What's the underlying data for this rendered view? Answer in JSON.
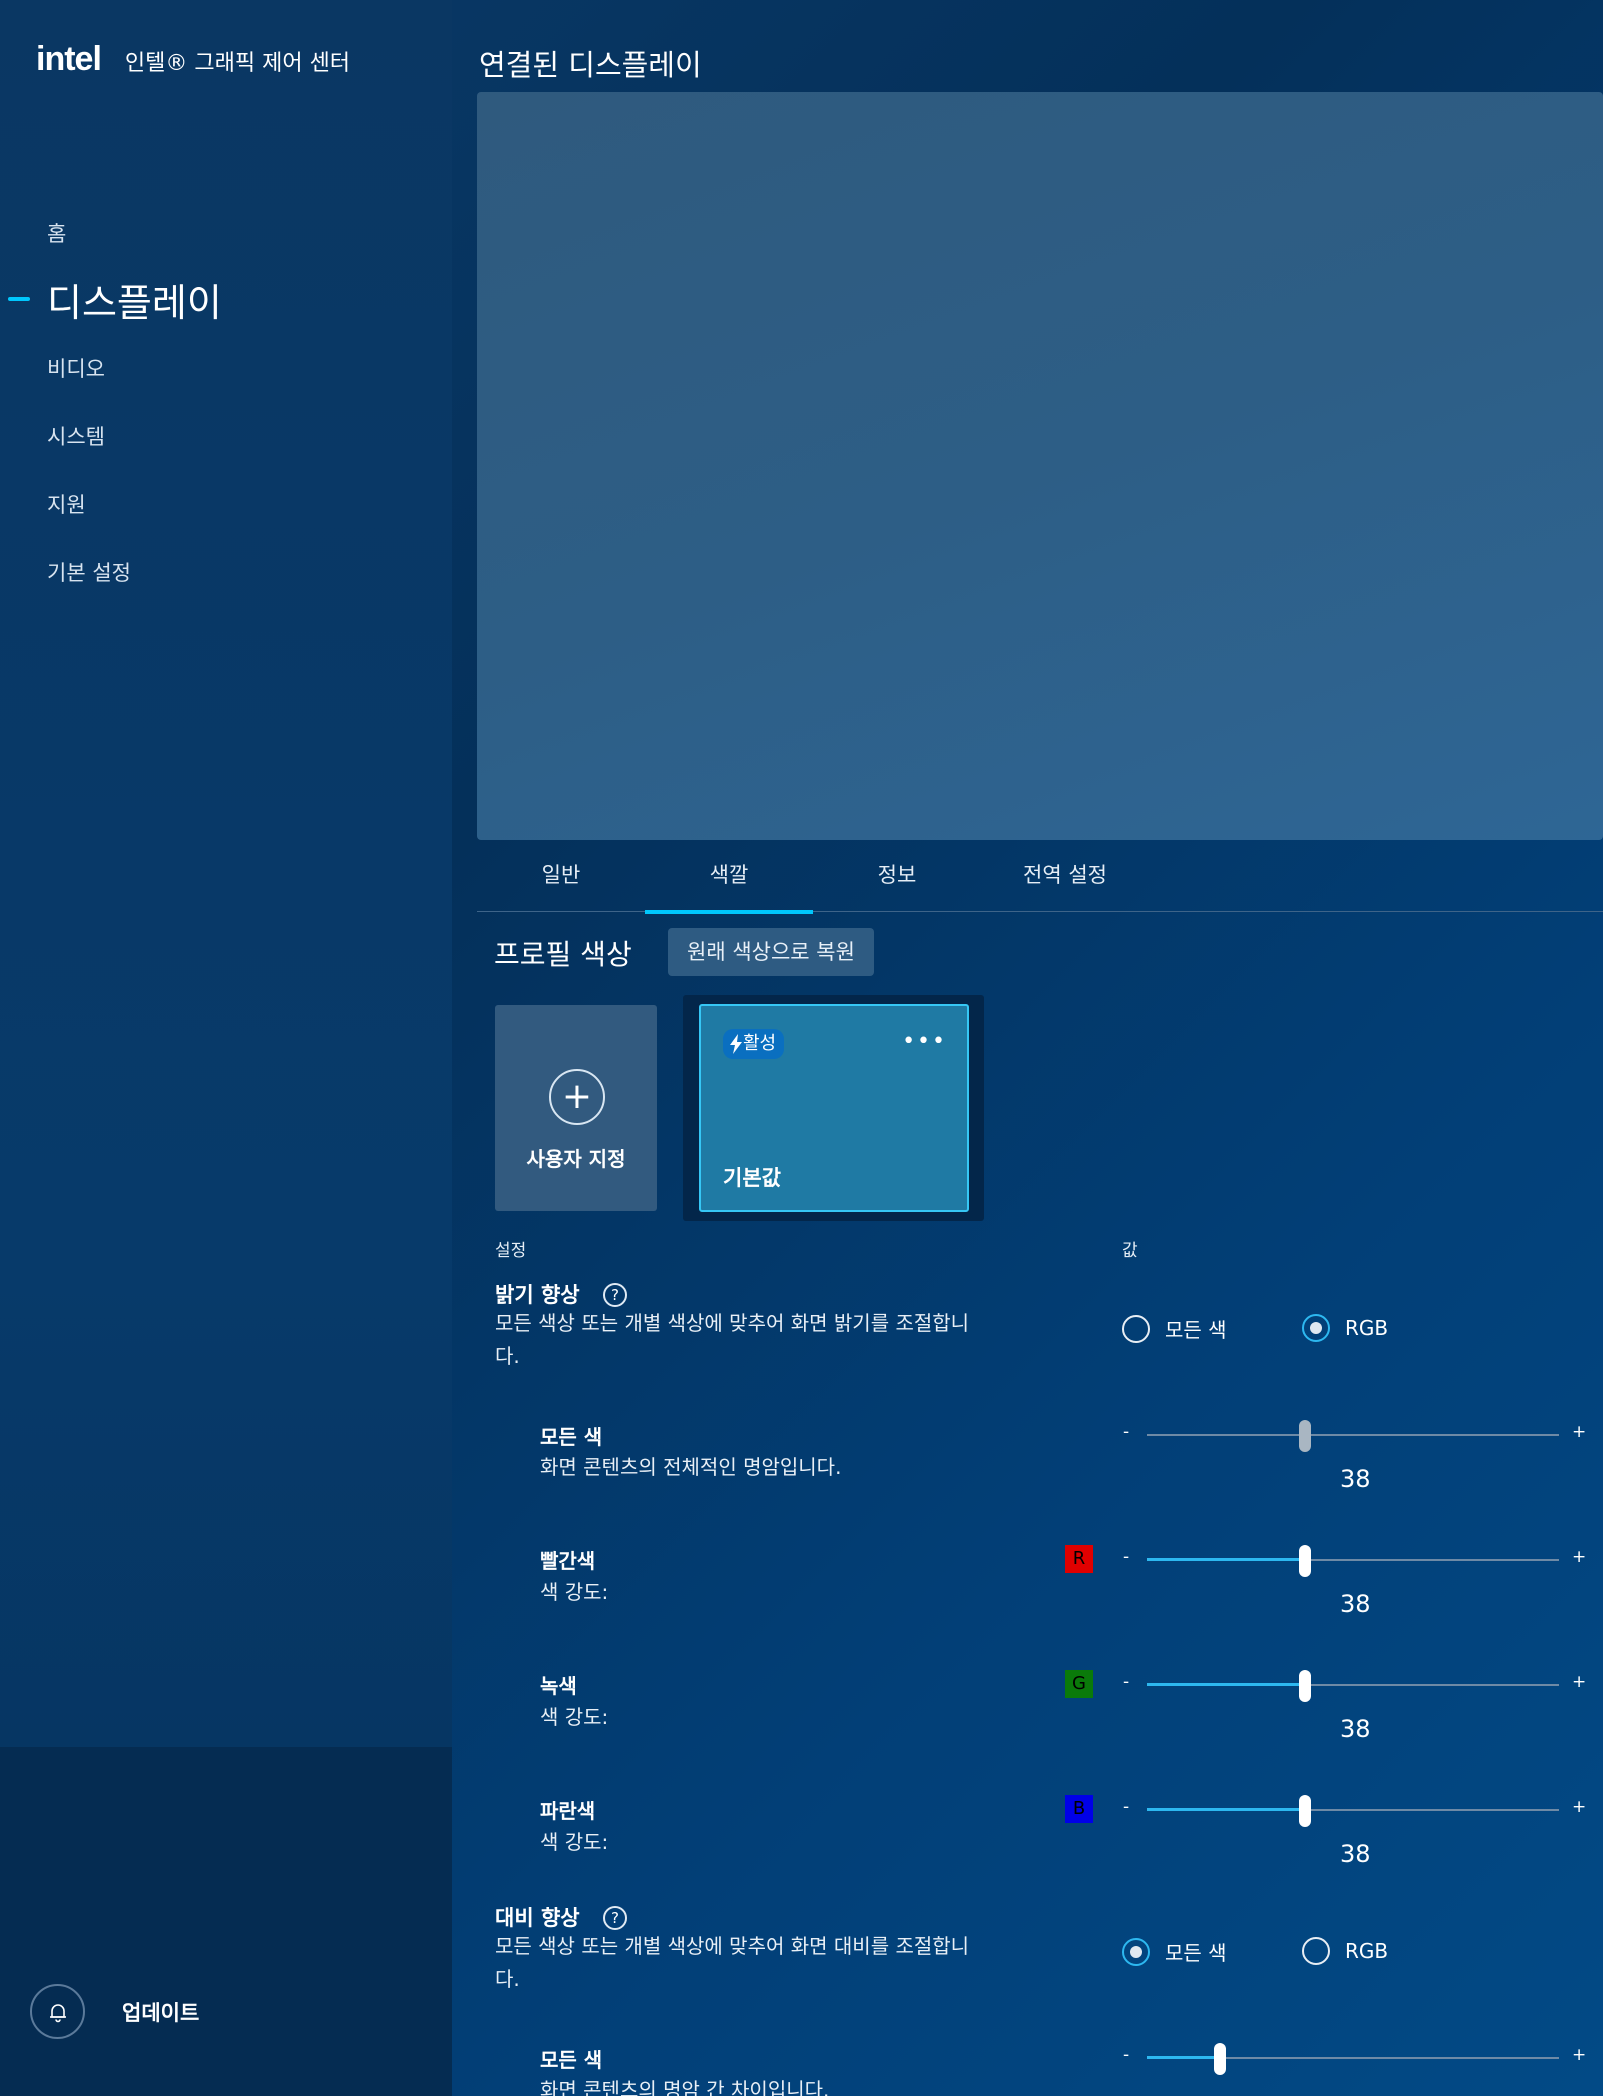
{
  "app": {
    "brand_logo": "intel",
    "name": "인텔® 그래픽 제어 센터"
  },
  "sidebar": {
    "items": [
      {
        "label": "홈"
      },
      {
        "label": "디스플레이",
        "active": true
      },
      {
        "label": "비디오"
      },
      {
        "label": "시스템"
      },
      {
        "label": "지원"
      },
      {
        "label": "기본 설정"
      }
    ],
    "update_label": "업데이트",
    "update_icon": "bell-icon"
  },
  "main": {
    "title": "연결된 디스플레이",
    "tabs": [
      {
        "label": "일반"
      },
      {
        "label": "색깔",
        "active": true
      },
      {
        "label": "정보"
      },
      {
        "label": "전역 설정"
      }
    ],
    "profile": {
      "title": "프로필 색상",
      "reset_label": "원래 색상으로 복원",
      "custom_card_label": "사용자 지정",
      "default_card_label": "기본값",
      "active_badge": "활성",
      "more_label": "•••"
    },
    "columns": {
      "setting": "설정",
      "value": "값"
    },
    "brightness": {
      "title": "밝기 향상",
      "help": "?",
      "desc_line1": "모든 색상 또는 개별 색상에 맞추어 화면 밝기를 조절합니",
      "desc_line2": "다.",
      "options": [
        "모든 색",
        "RGB"
      ],
      "selected": "RGB",
      "all_colors": {
        "title": "모든 색",
        "desc": "화면 콘텐츠의 전체적인 명암입니다.",
        "value": 38,
        "enabled": false
      },
      "red": {
        "title": "빨간색",
        "desc": "색 강도:",
        "chip": "R",
        "chip_color": "#e00000",
        "value": 38
      },
      "green": {
        "title": "녹색",
        "desc": "색 강도:",
        "chip": "G",
        "chip_color": "#0a7a0a",
        "value": 38
      },
      "blue": {
        "title": "파란색",
        "desc": "색 강도:",
        "chip": "B",
        "chip_color": "#0000e8",
        "value": 38
      }
    },
    "contrast": {
      "title": "대비 향상",
      "help": "?",
      "desc_line1": "모든 색상 또는 개별 색상에 맞추어 화면 대비를 조절합니",
      "desc_line2": "다.",
      "options": [
        "모든 색",
        "RGB"
      ],
      "selected": "모든 색",
      "all_colors": {
        "title": "모든 색",
        "desc": "화면 콘텐츠의 명암 간 차이입니다."
      }
    },
    "slider_minus": "-",
    "slider_plus": "+"
  },
  "colors": {
    "accent": "#00c7fd",
    "slider_fill": "#2db8f0"
  }
}
